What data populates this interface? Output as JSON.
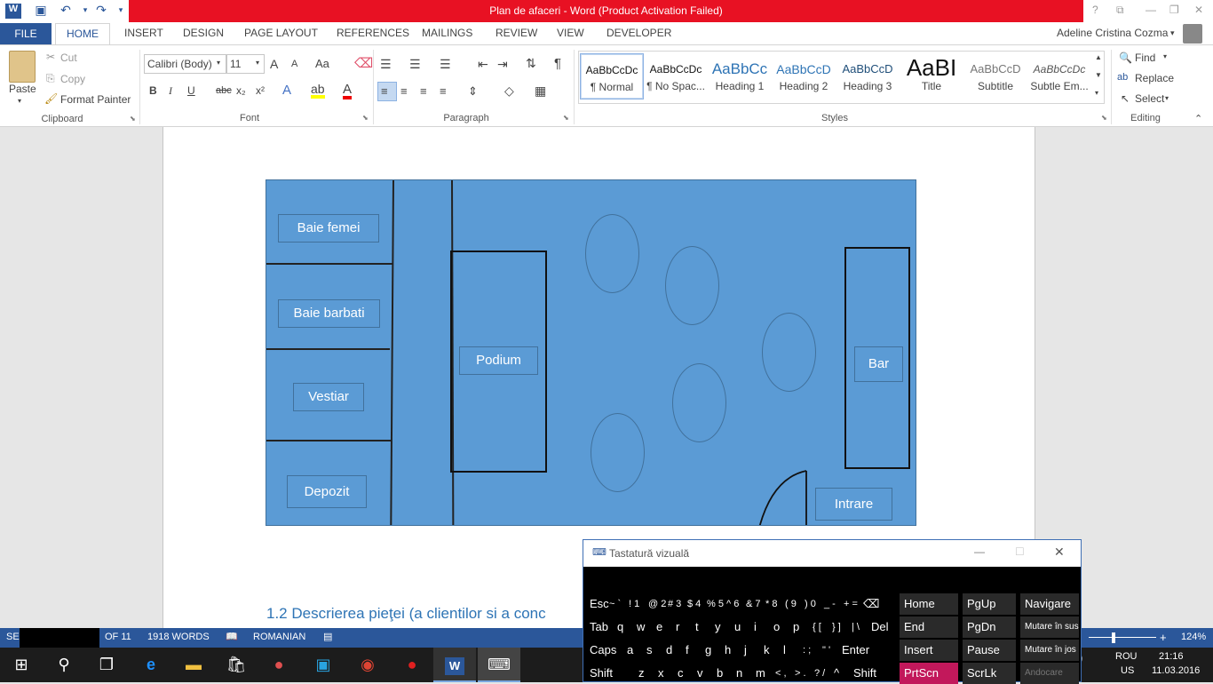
{
  "window": {
    "title": "Plan de afaceri -  Word (Product Activation Failed)",
    "user": "Adeline Cristina Cozma",
    "help": "?"
  },
  "quick_access": {
    "save_icon": "save-icon",
    "undo_icon": "undo-icon",
    "redo_icon": "redo-icon"
  },
  "tabs": {
    "file": "FILE",
    "home": "HOME",
    "insert": "INSERT",
    "design": "DESIGN",
    "page_layout": "PAGE LAYOUT",
    "references": "REFERENCES",
    "mailings": "MAILINGS",
    "review": "REVIEW",
    "view": "VIEW",
    "developer": "DEVELOPER"
  },
  "clipboard": {
    "paste": "Paste",
    "cut": "Cut",
    "copy": "Copy",
    "format_painter": "Format Painter",
    "group": "Clipboard"
  },
  "font": {
    "family": "Calibri (Body)",
    "size": "11",
    "group": "Font",
    "bold": "B",
    "italic": "I",
    "underline": "U",
    "strike": "abc",
    "sub": "x₂",
    "sup": "x²",
    "case": "Aa",
    "grow": "A",
    "shrink": "A"
  },
  "paragraph": {
    "group": "Paragraph",
    "pilcrow": "¶"
  },
  "styles": {
    "group": "Styles",
    "items": [
      {
        "preview": "AaBbCcDc",
        "name": "¶ Normal"
      },
      {
        "preview": "AaBbCcDc",
        "name": "¶ No Spac..."
      },
      {
        "preview": "AaBbCc",
        "name": "Heading 1"
      },
      {
        "preview": "AaBbCcD",
        "name": "Heading 2"
      },
      {
        "preview": "AaBbCcD",
        "name": "Heading 3"
      },
      {
        "preview": "AaBI",
        "name": "Title"
      },
      {
        "preview": "AaBbCcD",
        "name": "Subtitle"
      },
      {
        "preview": "AaBbCcDc",
        "name": "Subtle Em..."
      }
    ]
  },
  "editing": {
    "find": "Find",
    "replace": "Replace",
    "select": "Select",
    "group": "Editing"
  },
  "floorplan": {
    "rooms": {
      "baie_femei": "Baie femei",
      "baie_barbati": "Baie barbati",
      "vestiar": "Vestiar",
      "depozit": "Depozit",
      "podium": "Podium",
      "bar": "Bar",
      "intrare": "Intrare"
    }
  },
  "document": {
    "heading": "1.2 Descrierea pieţei (a clientilor si a conc"
  },
  "status": {
    "section": "SEC",
    "page": "OF 11",
    "words": "1918 WORDS",
    "language": "ROMANIAN",
    "zoom": "124%"
  },
  "osk": {
    "title": "Tastatură vizuală",
    "rows": [
      [
        "Esc",
        "~ `",
        "! 1",
        "@ 2",
        "# 3",
        "$ 4",
        "% 5",
        "^ 6",
        "& 7",
        "* 8",
        "( 9",
        ") 0",
        "_ -",
        "+ =",
        "⌫"
      ],
      [
        "Tab",
        "q",
        "w",
        "e",
        "r",
        "t",
        "y",
        "u",
        "i",
        "o",
        "p",
        "{ [",
        "} ]",
        "| \\",
        "Del"
      ],
      [
        "Caps",
        "a",
        "s",
        "d",
        "f",
        "g",
        "h",
        "j",
        "k",
        "l",
        ": ;",
        "\" '",
        "Enter"
      ],
      [
        "Shift",
        "z",
        "x",
        "c",
        "v",
        "b",
        "n",
        "m",
        "< ,",
        "> .",
        "? /",
        "^",
        "Shift"
      ]
    ],
    "nav": [
      [
        "Home",
        "PgUp",
        "Navigare"
      ],
      [
        "End",
        "PgDn",
        "Mutare în sus"
      ],
      [
        "Insert",
        "Pause",
        "Mutare în jos"
      ],
      [
        "PrtScn",
        "ScrLk",
        "Andocare"
      ]
    ]
  },
  "taskbar": {
    "lang": "ROU",
    "region": "US",
    "time": "21:16",
    "date": "11.03.2016"
  }
}
